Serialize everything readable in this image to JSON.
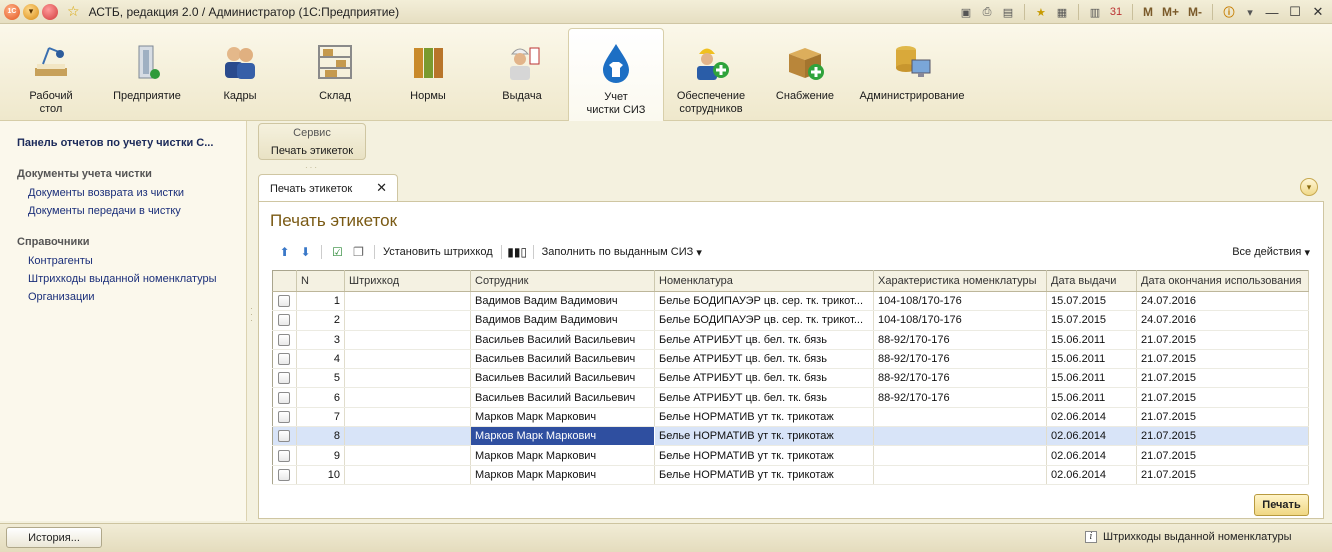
{
  "window": {
    "title": "АСТБ, редакция 2.0 / Администратор  (1С:Предприятие)",
    "mem_buttons": [
      "M",
      "M+",
      "M-"
    ]
  },
  "sections": [
    {
      "label": "Рабочий\nстол",
      "icon": "desk-lamp-icon"
    },
    {
      "label": "Предприятие",
      "icon": "building-icon"
    },
    {
      "label": "Кадры",
      "icon": "people-icon"
    },
    {
      "label": "Склад",
      "icon": "warehouse-icon"
    },
    {
      "label": "Нормы",
      "icon": "folders-icon"
    },
    {
      "label": "Выдача",
      "icon": "worker-icon"
    },
    {
      "label": "Учет\nчистки СИЗ",
      "icon": "water-drop-shirt-icon",
      "active": true
    },
    {
      "label": "Обеспечение\nсотрудников",
      "icon": "worker-add-icon"
    },
    {
      "label": "Снабжение",
      "icon": "box-add-icon"
    },
    {
      "label": "Администрирование",
      "icon": "database-computer-icon"
    }
  ],
  "left_panel": {
    "title": "Панель отчетов по учету чистки С...",
    "groups": [
      {
        "label": "Документы учета чистки",
        "items": [
          "Документы возврата из чистки",
          "Документы передачи в чистку"
        ]
      },
      {
        "label": "Справочники",
        "items": [
          "Контрагенты",
          "Штрихкоды выданной номенклатуры",
          "Организации"
        ]
      }
    ]
  },
  "service": {
    "header": "Сервис",
    "item": "Печать этикеток"
  },
  "tab": {
    "label": "Печать этикеток",
    "close": "✕"
  },
  "form": {
    "title": "Печать этикеток",
    "toolbar": {
      "set_barcode": "Установить штрихкод",
      "fill": "Заполнить по выданным СИЗ",
      "all_actions": "Все действия"
    },
    "columns": [
      "",
      "N",
      "Штрихкод",
      "Сотрудник",
      "Номенклатура",
      "Характеристика номенклатуры",
      "Дата выдачи",
      "Дата окончания использования"
    ],
    "rows": [
      {
        "n": "1",
        "barcode": "",
        "employee": "Вадимов Вадим Вадимович",
        "item": "Белье БОДИПАУЭР цв. сер. тк. трикот...",
        "char": "104-108/170-176",
        "issued": "15.07.2015",
        "end": "24.07.2016"
      },
      {
        "n": "2",
        "barcode": "",
        "employee": "Вадимов Вадим Вадимович",
        "item": "Белье БОДИПАУЭР цв. сер. тк. трикот...",
        "char": "104-108/170-176",
        "issued": "15.07.2015",
        "end": "24.07.2016"
      },
      {
        "n": "3",
        "barcode": "",
        "employee": "Васильев Василий Васильевич",
        "item": "Белье АТРИБУТ цв. бел. тк. бязь",
        "char": "88-92/170-176",
        "issued": "15.06.2011",
        "end": "21.07.2015"
      },
      {
        "n": "4",
        "barcode": "",
        "employee": "Васильев Василий Васильевич",
        "item": "Белье АТРИБУТ цв. бел. тк. бязь",
        "char": "88-92/170-176",
        "issued": "15.06.2011",
        "end": "21.07.2015"
      },
      {
        "n": "5",
        "barcode": "",
        "employee": "Васильев Василий Васильевич",
        "item": "Белье АТРИБУТ цв. бел. тк. бязь",
        "char": "88-92/170-176",
        "issued": "15.06.2011",
        "end": "21.07.2015"
      },
      {
        "n": "6",
        "barcode": "",
        "employee": "Васильев Василий Васильевич",
        "item": "Белье АТРИБУТ цв. бел. тк. бязь",
        "char": "88-92/170-176",
        "issued": "15.06.2011",
        "end": "21.07.2015"
      },
      {
        "n": "7",
        "barcode": "",
        "employee": "Марков Марк Маркович",
        "item": "Белье НОРМАТИВ ут тк. трикотаж",
        "char": "",
        "issued": "02.06.2014",
        "end": "21.07.2015"
      },
      {
        "n": "8",
        "barcode": "",
        "employee": "Марков Марк Маркович",
        "item": "Белье НОРМАТИВ ут тк. трикотаж",
        "char": "",
        "issued": "02.06.2014",
        "end": "21.07.2015",
        "selected": true
      },
      {
        "n": "9",
        "barcode": "",
        "employee": "Марков Марк Маркович",
        "item": "Белье НОРМАТИВ ут тк. трикотаж",
        "char": "",
        "issued": "02.06.2014",
        "end": "21.07.2015"
      },
      {
        "n": "10",
        "barcode": "",
        "employee": "Марков Марк Маркович",
        "item": "Белье НОРМАТИВ ут тк. трикотаж",
        "char": "",
        "issued": "02.06.2014",
        "end": "21.07.2015"
      }
    ],
    "print_button": "Печать"
  },
  "status": {
    "history_button": "История...",
    "info_text": "Штрихкоды выданной номенклатуры"
  },
  "colors": {
    "accent": "#7a5a14",
    "link": "#1b2f7a",
    "selection": "#2f4fa0"
  }
}
